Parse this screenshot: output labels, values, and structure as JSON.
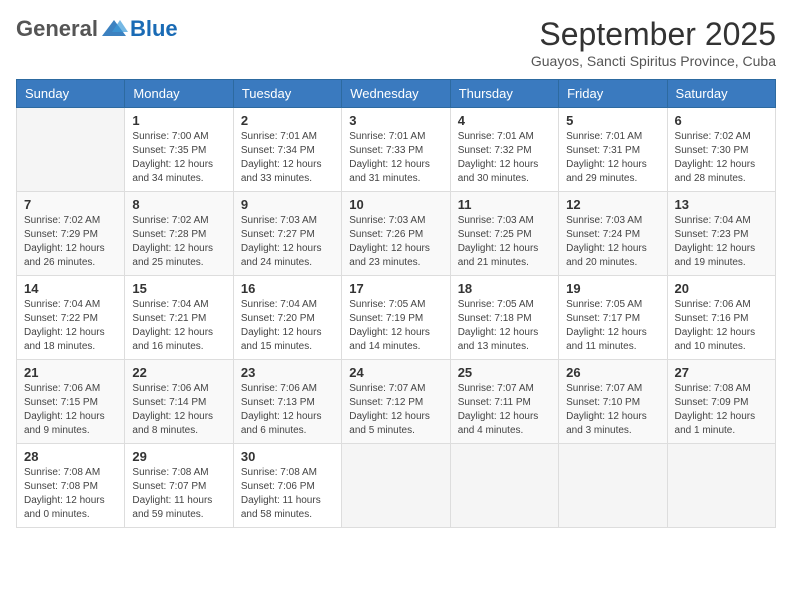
{
  "logo": {
    "general": "General",
    "blue": "Blue"
  },
  "header": {
    "month_title": "September 2025",
    "subtitle": "Guayos, Sancti Spiritus Province, Cuba"
  },
  "weekdays": [
    "Sunday",
    "Monday",
    "Tuesday",
    "Wednesday",
    "Thursday",
    "Friday",
    "Saturday"
  ],
  "weeks": [
    [
      {
        "day": "",
        "info": ""
      },
      {
        "day": "1",
        "info": "Sunrise: 7:00 AM\nSunset: 7:35 PM\nDaylight: 12 hours\nand 34 minutes."
      },
      {
        "day": "2",
        "info": "Sunrise: 7:01 AM\nSunset: 7:34 PM\nDaylight: 12 hours\nand 33 minutes."
      },
      {
        "day": "3",
        "info": "Sunrise: 7:01 AM\nSunset: 7:33 PM\nDaylight: 12 hours\nand 31 minutes."
      },
      {
        "day": "4",
        "info": "Sunrise: 7:01 AM\nSunset: 7:32 PM\nDaylight: 12 hours\nand 30 minutes."
      },
      {
        "day": "5",
        "info": "Sunrise: 7:01 AM\nSunset: 7:31 PM\nDaylight: 12 hours\nand 29 minutes."
      },
      {
        "day": "6",
        "info": "Sunrise: 7:02 AM\nSunset: 7:30 PM\nDaylight: 12 hours\nand 28 minutes."
      }
    ],
    [
      {
        "day": "7",
        "info": "Sunrise: 7:02 AM\nSunset: 7:29 PM\nDaylight: 12 hours\nand 26 minutes."
      },
      {
        "day": "8",
        "info": "Sunrise: 7:02 AM\nSunset: 7:28 PM\nDaylight: 12 hours\nand 25 minutes."
      },
      {
        "day": "9",
        "info": "Sunrise: 7:03 AM\nSunset: 7:27 PM\nDaylight: 12 hours\nand 24 minutes."
      },
      {
        "day": "10",
        "info": "Sunrise: 7:03 AM\nSunset: 7:26 PM\nDaylight: 12 hours\nand 23 minutes."
      },
      {
        "day": "11",
        "info": "Sunrise: 7:03 AM\nSunset: 7:25 PM\nDaylight: 12 hours\nand 21 minutes."
      },
      {
        "day": "12",
        "info": "Sunrise: 7:03 AM\nSunset: 7:24 PM\nDaylight: 12 hours\nand 20 minutes."
      },
      {
        "day": "13",
        "info": "Sunrise: 7:04 AM\nSunset: 7:23 PM\nDaylight: 12 hours\nand 19 minutes."
      }
    ],
    [
      {
        "day": "14",
        "info": "Sunrise: 7:04 AM\nSunset: 7:22 PM\nDaylight: 12 hours\nand 18 minutes."
      },
      {
        "day": "15",
        "info": "Sunrise: 7:04 AM\nSunset: 7:21 PM\nDaylight: 12 hours\nand 16 minutes."
      },
      {
        "day": "16",
        "info": "Sunrise: 7:04 AM\nSunset: 7:20 PM\nDaylight: 12 hours\nand 15 minutes."
      },
      {
        "day": "17",
        "info": "Sunrise: 7:05 AM\nSunset: 7:19 PM\nDaylight: 12 hours\nand 14 minutes."
      },
      {
        "day": "18",
        "info": "Sunrise: 7:05 AM\nSunset: 7:18 PM\nDaylight: 12 hours\nand 13 minutes."
      },
      {
        "day": "19",
        "info": "Sunrise: 7:05 AM\nSunset: 7:17 PM\nDaylight: 12 hours\nand 11 minutes."
      },
      {
        "day": "20",
        "info": "Sunrise: 7:06 AM\nSunset: 7:16 PM\nDaylight: 12 hours\nand 10 minutes."
      }
    ],
    [
      {
        "day": "21",
        "info": "Sunrise: 7:06 AM\nSunset: 7:15 PM\nDaylight: 12 hours\nand 9 minutes."
      },
      {
        "day": "22",
        "info": "Sunrise: 7:06 AM\nSunset: 7:14 PM\nDaylight: 12 hours\nand 8 minutes."
      },
      {
        "day": "23",
        "info": "Sunrise: 7:06 AM\nSunset: 7:13 PM\nDaylight: 12 hours\nand 6 minutes."
      },
      {
        "day": "24",
        "info": "Sunrise: 7:07 AM\nSunset: 7:12 PM\nDaylight: 12 hours\nand 5 minutes."
      },
      {
        "day": "25",
        "info": "Sunrise: 7:07 AM\nSunset: 7:11 PM\nDaylight: 12 hours\nand 4 minutes."
      },
      {
        "day": "26",
        "info": "Sunrise: 7:07 AM\nSunset: 7:10 PM\nDaylight: 12 hours\nand 3 minutes."
      },
      {
        "day": "27",
        "info": "Sunrise: 7:08 AM\nSunset: 7:09 PM\nDaylight: 12 hours\nand 1 minute."
      }
    ],
    [
      {
        "day": "28",
        "info": "Sunrise: 7:08 AM\nSunset: 7:08 PM\nDaylight: 12 hours\nand 0 minutes."
      },
      {
        "day": "29",
        "info": "Sunrise: 7:08 AM\nSunset: 7:07 PM\nDaylight: 11 hours\nand 59 minutes."
      },
      {
        "day": "30",
        "info": "Sunrise: 7:08 AM\nSunset: 7:06 PM\nDaylight: 11 hours\nand 58 minutes."
      },
      {
        "day": "",
        "info": ""
      },
      {
        "day": "",
        "info": ""
      },
      {
        "day": "",
        "info": ""
      },
      {
        "day": "",
        "info": ""
      }
    ]
  ]
}
